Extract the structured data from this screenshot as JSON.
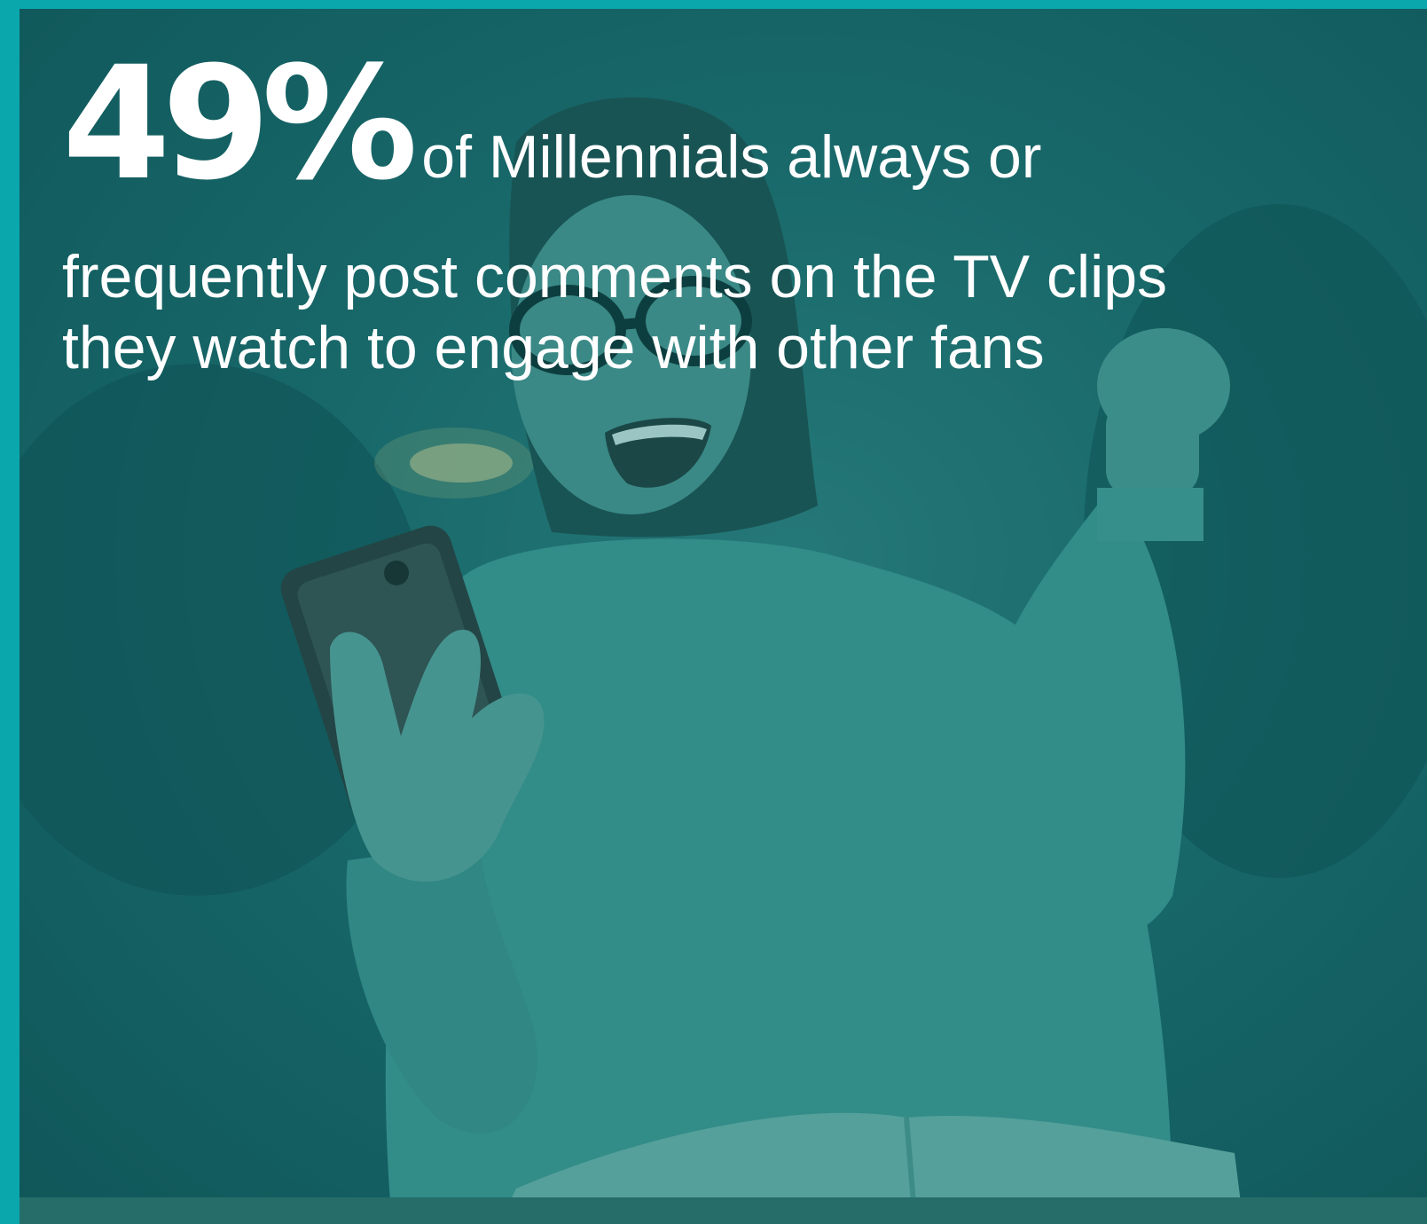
{
  "stat": {
    "value": "49%",
    "lead": "of Millennials always or",
    "line2": "frequently post comments on the TV clips",
    "line3": "they watch to engage with other fans"
  },
  "colors": {
    "border": "#0aa7ad",
    "overlay": "#1b6869",
    "text": "#ffffff"
  }
}
